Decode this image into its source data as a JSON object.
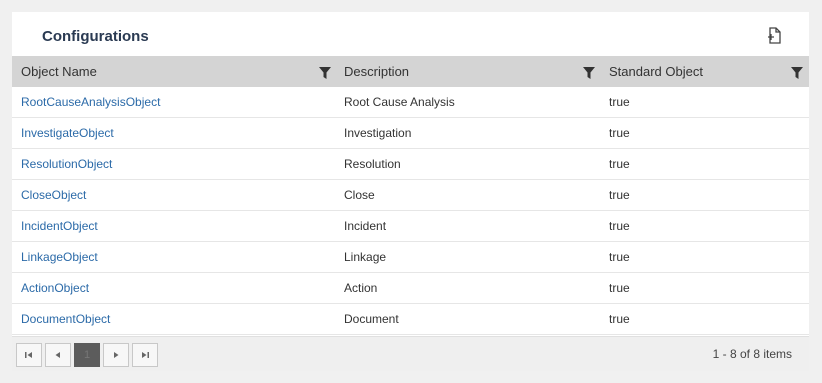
{
  "panel": {
    "title": "Configurations",
    "export_icon": "export-file-icon"
  },
  "grid": {
    "columns": [
      {
        "label": "Object Name"
      },
      {
        "label": "Description"
      },
      {
        "label": "Standard Object"
      }
    ],
    "rows": [
      {
        "name": "RootCauseAnalysisObject",
        "description": "Root Cause Analysis",
        "standard": "true"
      },
      {
        "name": "InvestigateObject",
        "description": "Investigation",
        "standard": "true"
      },
      {
        "name": "ResolutionObject",
        "description": "Resolution",
        "standard": "true"
      },
      {
        "name": "CloseObject",
        "description": "Close",
        "standard": "true"
      },
      {
        "name": "IncidentObject",
        "description": "Incident",
        "standard": "true"
      },
      {
        "name": "LinkageObject",
        "description": "Linkage",
        "standard": "true"
      },
      {
        "name": "ActionObject",
        "description": "Action",
        "standard": "true"
      },
      {
        "name": "DocumentObject",
        "description": "Document",
        "standard": "true"
      }
    ]
  },
  "pager": {
    "current_page": "1",
    "info": "1 - 8 of 8 items"
  },
  "colors": {
    "link": "#2b6aa8",
    "header_bg": "#d4d4d4",
    "title": "#2a3a52"
  }
}
